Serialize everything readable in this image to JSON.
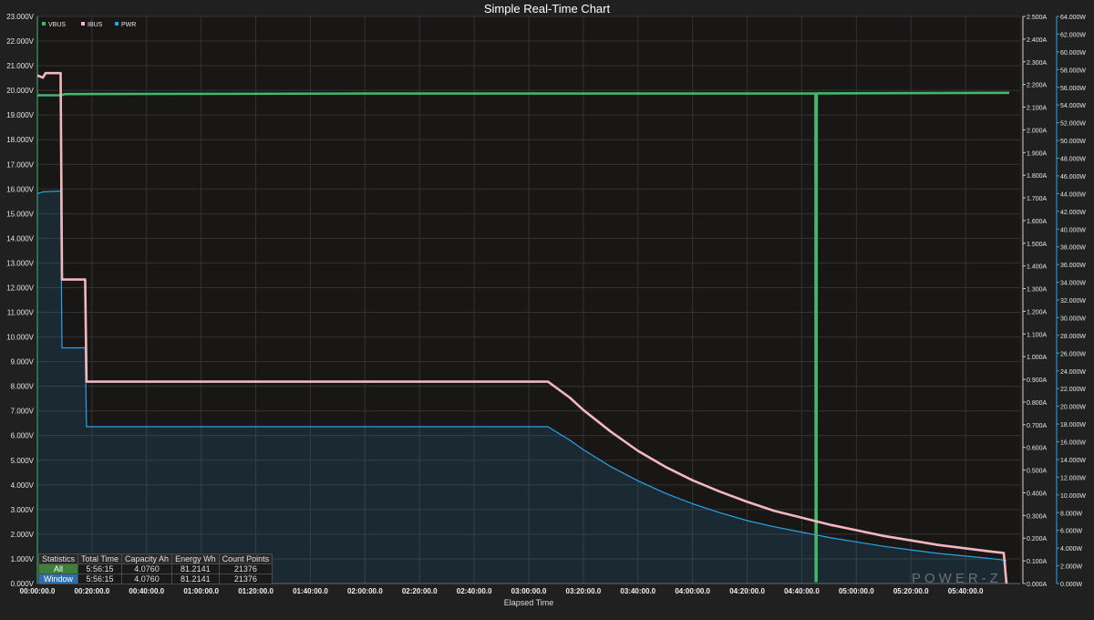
{
  "brand": "POWER-Z",
  "chart_data": {
    "type": "line",
    "title": "Simple Real-Time Chart",
    "xlabel": "Elapsed Time",
    "x_ticks": [
      "00:00:00.0",
      "00:20:00.0",
      "00:40:00.0",
      "01:00:00.0",
      "01:20:00.0",
      "01:40:00.0",
      "02:00:00.0",
      "02:20:00.0",
      "02:40:00.0",
      "03:00:00.0",
      "03:20:00.0",
      "03:40:00.0",
      "04:00:00.0",
      "04:20:00.0",
      "04:40:00.0",
      "05:00:00.0",
      "05:20:00.0",
      "05:40:00.0"
    ],
    "x_range_min": [
      0,
      360
    ],
    "grid": true,
    "legend_position": "top-left",
    "axes": {
      "voltage": {
        "unit": "V",
        "range": [
          0,
          23
        ],
        "ticks": [
          "0.000V",
          "1.000V",
          "2.000V",
          "3.000V",
          "4.000V",
          "5.000V",
          "6.000V",
          "7.000V",
          "8.000V",
          "9.000V",
          "10.000V",
          "11.000V",
          "12.000V",
          "13.000V",
          "14.000V",
          "15.000V",
          "16.000V",
          "17.000V",
          "18.000V",
          "19.000V",
          "20.000V",
          "21.000V",
          "22.000V",
          "23.000V"
        ]
      },
      "current": {
        "unit": "A",
        "range": [
          0,
          2.5
        ],
        "ticks": [
          "0.000A",
          "0.100A",
          "0.200A",
          "0.300A",
          "0.400A",
          "0.500A",
          "0.600A",
          "0.700A",
          "0.800A",
          "0.900A",
          "1.000A",
          "1.100A",
          "1.200A",
          "1.300A",
          "1.400A",
          "1.500A",
          "1.600A",
          "1.700A",
          "1.800A",
          "1.900A",
          "2.000A",
          "2.100A",
          "2.200A",
          "2.300A",
          "2.400A",
          "2.500A"
        ]
      },
      "power": {
        "unit": "W",
        "range": [
          0,
          64
        ],
        "ticks": [
          "0.000W",
          "2.000W",
          "4.000W",
          "6.000W",
          "8.000W",
          "10.000W",
          "12.000W",
          "14.000W",
          "16.000W",
          "18.000W",
          "20.000W",
          "22.000W",
          "24.000W",
          "26.000W",
          "28.000W",
          "30.000W",
          "32.000W",
          "34.000W",
          "36.000W",
          "38.000W",
          "40.000W",
          "42.000W",
          "44.000W",
          "46.000W",
          "48.000W",
          "50.000W",
          "52.000W",
          "54.000W",
          "56.000W",
          "58.000W",
          "60.000W",
          "62.000W",
          "64.000W"
        ]
      }
    },
    "series": [
      {
        "name": "VBUS",
        "axis": "voltage",
        "color": "#3fb96a",
        "points": [
          [
            0,
            19.8
          ],
          [
            8.5,
            19.8
          ],
          [
            10,
            19.85
          ],
          [
            120,
            19.87
          ],
          [
            285,
            19.87
          ],
          [
            285.1,
            0.1
          ],
          [
            285.4,
            0.1
          ],
          [
            285.5,
            19.88
          ],
          [
            356,
            19.9
          ]
        ]
      },
      {
        "name": "IBUS",
        "axis": "current",
        "color": "#f4b6bf",
        "points": [
          [
            0,
            2.24
          ],
          [
            2,
            2.23
          ],
          [
            3,
            2.25
          ],
          [
            8.5,
            2.25
          ],
          [
            9,
            1.34
          ],
          [
            17.5,
            1.34
          ],
          [
            18,
            0.89
          ],
          [
            60,
            0.89
          ],
          [
            120,
            0.89
          ],
          [
            180,
            0.89
          ],
          [
            187,
            0.89
          ],
          [
            195,
            0.82
          ],
          [
            200,
            0.765
          ],
          [
            210,
            0.67
          ],
          [
            220,
            0.585
          ],
          [
            230,
            0.515
          ],
          [
            240,
            0.455
          ],
          [
            250,
            0.405
          ],
          [
            260,
            0.36
          ],
          [
            270,
            0.32
          ],
          [
            280,
            0.29
          ],
          [
            290,
            0.26
          ],
          [
            300,
            0.235
          ],
          [
            310,
            0.21
          ],
          [
            320,
            0.19
          ],
          [
            330,
            0.17
          ],
          [
            340,
            0.155
          ],
          [
            350,
            0.14
          ],
          [
            354,
            0.135
          ],
          [
            355,
            0.0
          ]
        ]
      },
      {
        "name": "PWR",
        "axis": "power",
        "color": "#29a3e8",
        "fill": true,
        "points": [
          [
            0,
            44.0
          ],
          [
            2,
            44.2
          ],
          [
            8.5,
            44.3
          ],
          [
            9,
            26.6
          ],
          [
            17.5,
            26.6
          ],
          [
            18,
            17.7
          ],
          [
            60,
            17.7
          ],
          [
            120,
            17.7
          ],
          [
            187,
            17.7
          ],
          [
            195,
            16.2
          ],
          [
            200,
            15.1
          ],
          [
            210,
            13.2
          ],
          [
            220,
            11.6
          ],
          [
            230,
            10.2
          ],
          [
            240,
            9.0
          ],
          [
            250,
            8.0
          ],
          [
            260,
            7.1
          ],
          [
            270,
            6.4
          ],
          [
            280,
            5.8
          ],
          [
            290,
            5.2
          ],
          [
            300,
            4.7
          ],
          [
            310,
            4.2
          ],
          [
            320,
            3.8
          ],
          [
            330,
            3.4
          ],
          [
            340,
            3.1
          ],
          [
            350,
            2.8
          ],
          [
            355,
            2.6
          ]
        ]
      }
    ]
  },
  "stats": {
    "headers": [
      "Statistics",
      "Total Time",
      "Capacity Ah",
      "Energy Wh",
      "Count Points"
    ],
    "rows": [
      [
        "All",
        "5:56:15",
        "4.0760",
        "81.2141",
        "21376"
      ],
      [
        "Window",
        "5:56:15",
        "4.0760",
        "81.2141",
        "21376"
      ]
    ]
  }
}
